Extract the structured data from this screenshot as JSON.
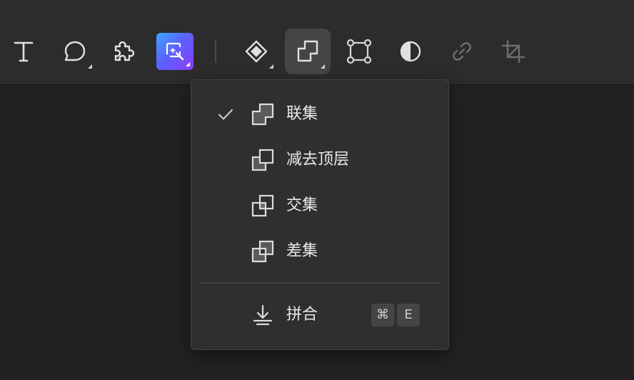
{
  "toolbar": {
    "tools": [
      {
        "name": "text",
        "icon": "text-icon"
      },
      {
        "name": "comment",
        "icon": "comment-icon"
      },
      {
        "name": "plugin",
        "icon": "puzzle-icon"
      },
      {
        "name": "ai",
        "icon": "ai-magic-icon"
      },
      {
        "name": "component",
        "icon": "diamond-icon"
      },
      {
        "name": "boolean",
        "icon": "boolean-union-icon",
        "active": true
      },
      {
        "name": "transform",
        "icon": "bounding-box-icon"
      },
      {
        "name": "mask",
        "icon": "half-circle-icon"
      },
      {
        "name": "link",
        "icon": "link-icon",
        "disabled": true
      },
      {
        "name": "crop",
        "icon": "crop-icon",
        "disabled": true
      }
    ]
  },
  "boolean_menu": {
    "items": [
      {
        "label": "联集",
        "icon": "union-icon",
        "checked": true
      },
      {
        "label": "减去顶层",
        "icon": "subtract-icon",
        "checked": false
      },
      {
        "label": "交集",
        "icon": "intersect-icon",
        "checked": false
      },
      {
        "label": "差集",
        "icon": "exclude-icon",
        "checked": false
      }
    ],
    "flatten": {
      "label": "拼合",
      "icon": "flatten-icon",
      "shortcut": [
        "⌘",
        "E"
      ]
    }
  },
  "colors": {
    "toolbar_bg": "#2c2c2c",
    "canvas_bg": "#222222",
    "menu_bg": "#2f2f2f",
    "active_tool_bg": "#454545",
    "ai_gradient_start": "#3ea6ff",
    "ai_gradient_end": "#8a3cf6"
  }
}
